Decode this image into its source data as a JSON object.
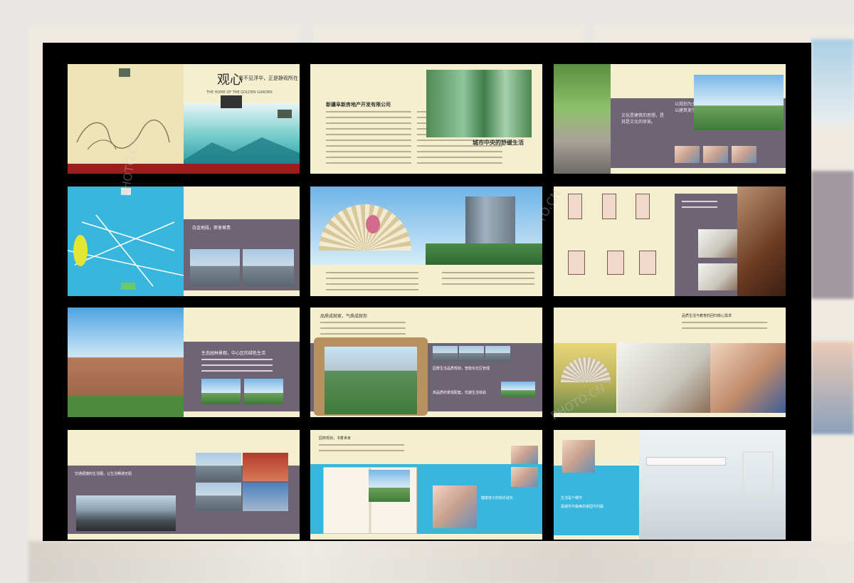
{
  "brochure": {
    "cover": {
      "brand_mark": "观心",
      "tagline": "看不见浮华，正是静观所在",
      "subtitle_en": "THE HOME OF THE GOLDEN GARDEN"
    },
    "company_page": {
      "company_name": "新疆阜新房地产开发有限公司",
      "headline": "城市中央的舒缓生活"
    },
    "culture_page": {
      "left_text": "文化是建筑的思想，是其是文化的审美。",
      "right_text": "以规划为主，以建筑美学"
    },
    "location_page": {
      "caption": "白金地段，荣享尊贵"
    },
    "garden_page": {
      "caption": "生态园林景观，中心区的绿色生活"
    },
    "landscape_page": {
      "top": "品质成就家，气质成就你",
      "right1": "园景生活品质规划，智能化社区管理",
      "right2": "高品质的景观配套，优越生活体验"
    },
    "kids_page": {
      "caption": "品质生活与教育的回归核心需求"
    },
    "transport_page": {
      "caption": "交通便捷的生活圈，让生活畅通无阻"
    },
    "education_page": {
      "top": "园林规划，书香世家",
      "right": "健康孩子的快乐成长"
    },
    "home_page": {
      "left_title": "生活是个细节",
      "left_sub": "是城市中最美的家园与归属"
    }
  },
  "watermark": {
    "text": "PHOTO.CN"
  }
}
